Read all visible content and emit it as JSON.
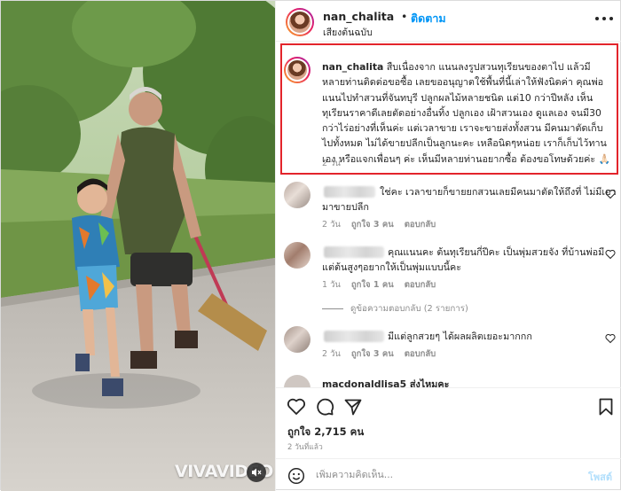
{
  "post": {
    "username": "nan_chalita",
    "separator": "•",
    "follow_label": "ติดตาม",
    "audio_label": "เสียงต้นฉบับ",
    "more_icon": "more-horizontal-icon"
  },
  "caption": {
    "username": "nan_chalita",
    "text": "สืบเนื่องจาก แนนลงรูปสวนทุเรียนของตาไป แล้วมีหลายท่านติดต่อขอซื้อ เลยขออนุญาตใช้พื้นที่นี้เล่าให้ฟังนิดค่า คุณพ่อแนนไปทำสวนที่จันทบุรี ปลูกผลไม้หลายชนิด แต่10 กว่าปีหลัง เห็นทุเรียนราคาดีเลยตัดอย่างอื่นทิ้ง ปลูกเอง เฝ้าสวนเอง ดูแลเอง จนมี30 กว่าไร่อย่างที่เห็นค่ะ แต่เวลาขาย เราจะขายส่งทั้งสวน มีคนมาตัดเก็บไปทั้งหมด ไม่ได้ขายปลีกเป็นลูกนะคะ เหลือนิดๆหน่อย เราก็เก็บไว้ทานเอง หรือแจกเพื่อนๆ ค่ะ เห็นมีหลายท่านอยากซื้อ ต้องขอโทษด้วยค่ะ 🙏🏻",
    "time": "2 วัน"
  },
  "comments": [
    {
      "text_line1": "ใช่คะ เวลาขายก็ขายยกสวนเลยมีคนมาตัดให้ถึงที่ ไม่มีเอา",
      "text_line2": "มาขายปลีก",
      "time": "2 วัน",
      "likes": "ถูกใจ 3 คน",
      "reply": "ตอบกลับ"
    },
    {
      "text_line1": "คุณแนนคะ ต้นทุเรียนกี่ปีคะ เป็นพุ่มสวยจัง ที่บ้านพ่อมี",
      "text_line2": "แต่ต้นสูงๆอยากให้เป็นพุ่มแบบนี้คะ",
      "time": "1 วัน",
      "likes": "ถูกใจ 1 คน",
      "reply": "ตอบกลับ"
    },
    {
      "text_line1": "มีแต่ลูกสวยๆ ได้ผลผลิตเยอะมากกก",
      "time": "2 วัน",
      "likes": "ถูกใจ 3 คน",
      "reply": "ตอบกลับ"
    },
    {
      "text_line1": "macdonaldlisa5 ส่งไหมคะ"
    }
  ],
  "view_replies": "ดูข้อความตอบกลับ (2 รายการ)",
  "actions": {
    "like_icon": "heart-icon",
    "comment_icon": "comment-icon",
    "share_icon": "share-icon",
    "save_icon": "bookmark-icon"
  },
  "likes": "ถูกใจ 2,715 คน",
  "date": "2 วันที่แล้ว",
  "composer": {
    "emoji_icon": "emoji-icon",
    "placeholder": "เพิ่มความคิดเห็น...",
    "post_label": "โพสต์"
  },
  "media": {
    "watermark": "VIVAVIDEO",
    "mute_icon": "speaker-muted-icon"
  },
  "colors": {
    "accent": "#0095f6",
    "highlight_border": "#e3242b",
    "muted_text": "#8e8e8e"
  }
}
